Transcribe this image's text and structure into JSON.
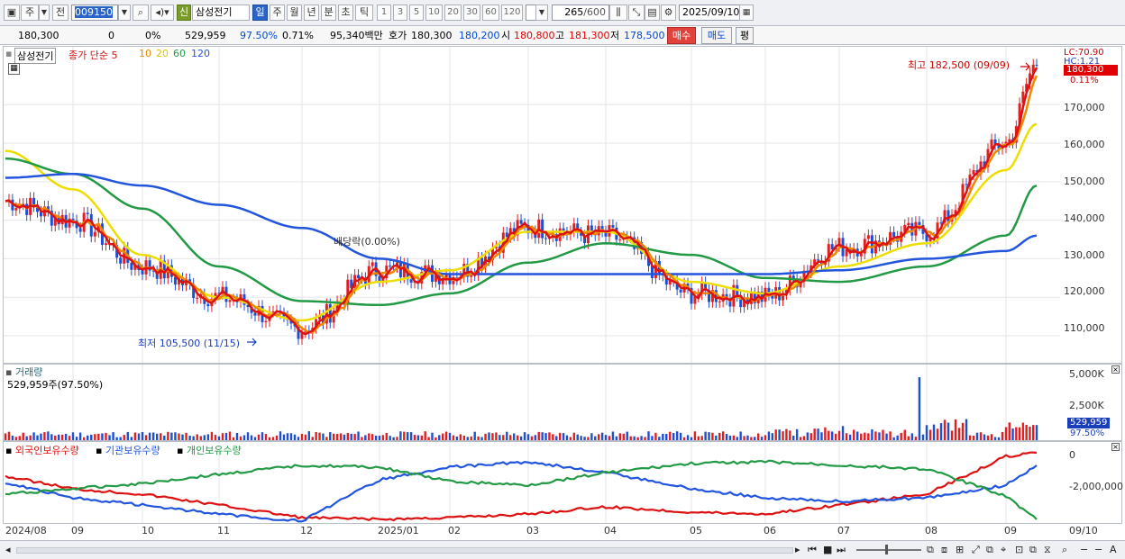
{
  "toolbar": {
    "market_label": "주",
    "prev_label": "전",
    "code": "009150",
    "credit_badge": "신",
    "stock_name": "삼성전기",
    "periods": [
      "일",
      "주",
      "월",
      "년",
      "분",
      "초",
      "틱"
    ],
    "intervals": [
      "1",
      "3",
      "5",
      "10",
      "20",
      "30",
      "60",
      "120"
    ],
    "count_value": "265",
    "count_total": "/600",
    "date": "2025/09/10"
  },
  "quote": {
    "price": "180,300",
    "change": "0",
    "change_rate": "0%",
    "volume": "529,959",
    "vol_ratio": "97.50%",
    "turnover_rate": "0.71%",
    "amount": "95,340백만",
    "ask_label": "호가",
    "ask": "180,300",
    "bid": "180,200",
    "open_label": "시",
    "open": "180,800",
    "high_label": "고",
    "high": "181,300",
    "low_label": "저",
    "low": "178,500",
    "buy_label": "매수",
    "sell_label": "매도",
    "avg_label": "평"
  },
  "price_panel": {
    "stock_label": "삼성전기",
    "legend": [
      "종가 단순 5",
      "10",
      "20",
      "60",
      "120"
    ],
    "legend_colors": [
      "#dd1111",
      "#ee8800",
      "#eedd00",
      "#229944",
      "#2255dd"
    ],
    "lc_label": "LC:70.90",
    "hc_label": "HC:1.21",
    "current_tag": "180,300",
    "current_pct": "0.11%",
    "high_note": "최고 182,500 (09/09)",
    "low_note": "최저 105,500 (11/15)",
    "dividend_note": "배당락(0.00%)",
    "y_ticks": [
      "170,000",
      "160,000",
      "150,000",
      "140,000",
      "130,000",
      "120,000",
      "110,000"
    ]
  },
  "volume_panel": {
    "title": "거래량",
    "value_note": "529,959주(97.50%)",
    "y_ticks": [
      "5,000K",
      "2,500K"
    ],
    "current_tag": "529,959",
    "current_pct": "97.50%"
  },
  "holding_panel": {
    "legend": [
      "외국인보유수량",
      "기관보유수량",
      "개인보유수량"
    ],
    "legend_colors": [
      "#dd1111",
      "#2255dd",
      "#229944"
    ],
    "y_ticks": [
      "0",
      "-2,000,000"
    ]
  },
  "x_axis": [
    "2024/08",
    "09",
    "10",
    "11",
    "12",
    "2025/01",
    "02",
    "03",
    "04",
    "05",
    "06",
    "07",
    "08",
    "09",
    "09/10"
  ],
  "chart_data": {
    "type": "line",
    "title": "",
    "x": [
      "2024/08",
      "09",
      "10",
      "11",
      "12",
      "2025/01",
      "02",
      "03",
      "04",
      "05",
      "06",
      "07",
      "08",
      "09",
      "09/10"
    ],
    "series": [
      {
        "name": "종가",
        "values": [
          145000,
          140000,
          128000,
          120000,
          112000,
          127000,
          126000,
          138000,
          136000,
          121000,
          120000,
          133000,
          137000,
          160000,
          180300
        ]
      },
      {
        "name": "20",
        "values": [
          158000,
          148000,
          131000,
          120000,
          114000,
          124000,
          127000,
          137000,
          137000,
          124000,
          121000,
          128000,
          134000,
          153000,
          165000
        ]
      },
      {
        "name": "60",
        "values": [
          156000,
          152000,
          143000,
          128000,
          119000,
          118000,
          121000,
          129000,
          134000,
          131000,
          125000,
          124000,
          128000,
          136000,
          149000
        ]
      },
      {
        "name": "120",
        "values": [
          151000,
          152000,
          149000,
          144000,
          138000,
          130000,
          126000,
          126000,
          126000,
          126000,
          126000,
          127000,
          130000,
          132000,
          136000
        ]
      }
    ],
    "y_ticks": [
      110000,
      120000,
      130000,
      140000,
      150000,
      160000,
      170000
    ],
    "ylim": [
      103000,
      185000
    ],
    "annotations": {
      "high": 182500,
      "high_date": "09/09",
      "low": 105500,
      "low_date": "11/15"
    }
  }
}
